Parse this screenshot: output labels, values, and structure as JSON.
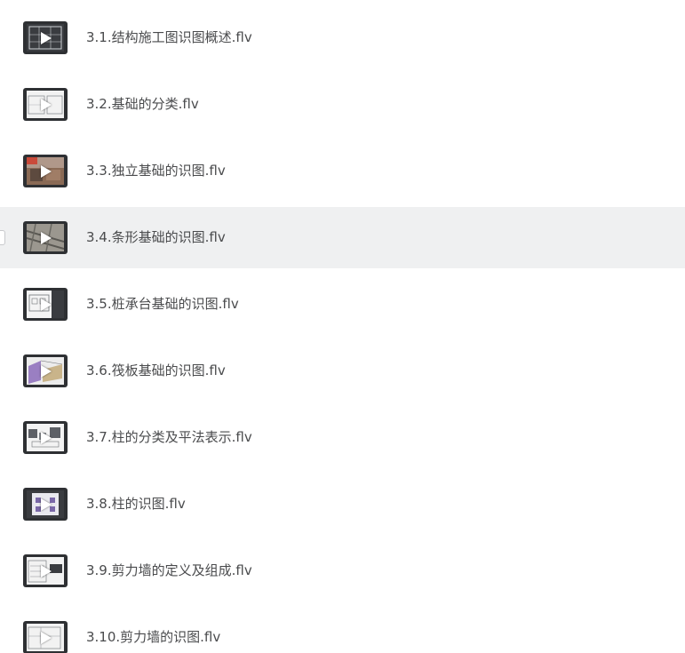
{
  "files": [
    {
      "name": "3.1.结构施工图识图概述.flv",
      "selected": false
    },
    {
      "name": "3.2.基础的分类.flv",
      "selected": false
    },
    {
      "name": "3.3.独立基础的识图.flv",
      "selected": false
    },
    {
      "name": "3.4.条形基础的识图.flv",
      "selected": true
    },
    {
      "name": "3.5.桩承台基础的识图.flv",
      "selected": false
    },
    {
      "name": "3.6.筏板基础的识图.flv",
      "selected": false
    },
    {
      "name": "3.7.柱的分类及平法表示.flv",
      "selected": false
    },
    {
      "name": "3.8.柱的识图.flv",
      "selected": false
    },
    {
      "name": "3.9.剪力墙的定义及组成.flv",
      "selected": false
    },
    {
      "name": "3.10.剪力墙的识图.flv",
      "selected": false
    }
  ],
  "thumbnail_icon": "play-icon",
  "colors": {
    "row_selected_background": "#eff0f1",
    "thumbnail_frame": "#2e3033",
    "file_name_text": "#4a4b4d"
  }
}
